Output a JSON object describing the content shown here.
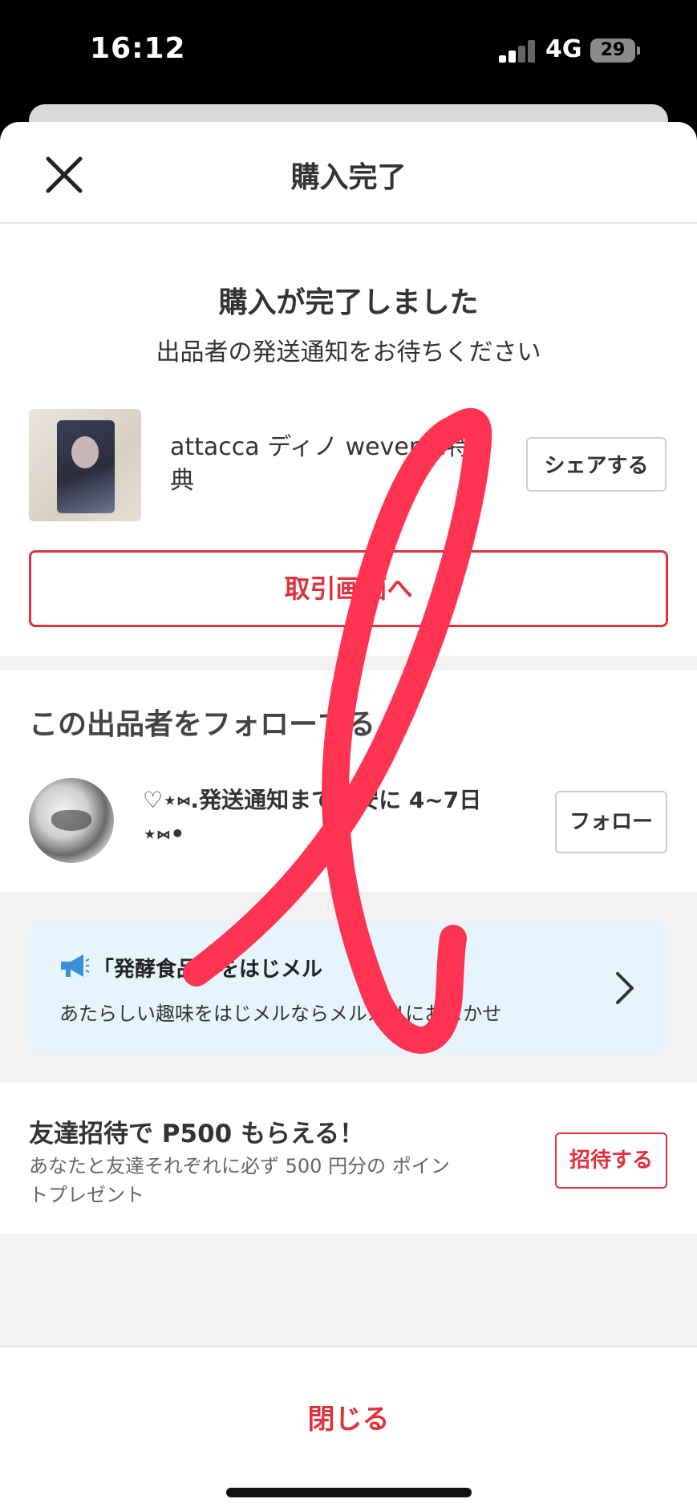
{
  "status_bar": {
    "time": "16:12",
    "network": "4G",
    "battery": "29"
  },
  "header": {
    "title": "購入完了"
  },
  "confirmation": {
    "title": "購入が完了しました",
    "subtitle": "出品者の発送通知をお待ちください"
  },
  "item": {
    "title": "attacca ディノ weverse特典",
    "share_label": "シェアする"
  },
  "trade_button": "取引画面へ",
  "seller_section": {
    "title": "この出品者をフォローする",
    "seller_name": "♡⋆⑅.発送通知まで目安に 4~7日 ⋆⑅•",
    "follow_label": "フォロー"
  },
  "banner": {
    "title": "「発酵食品」をはじメル",
    "text": "あたらしい趣味をはじメルならメルカリにおまかせ"
  },
  "invite": {
    "title": "友達招待で P500 もらえる！",
    "description": "あなたと友達それぞれに必ず 500 円分の ポイントプレゼント",
    "button_label": "招待する"
  },
  "close_label": "閉じる",
  "colors": {
    "accent": "#e0323f",
    "banner_bg": "#e6f5fd",
    "scribble": "#ff3352"
  }
}
